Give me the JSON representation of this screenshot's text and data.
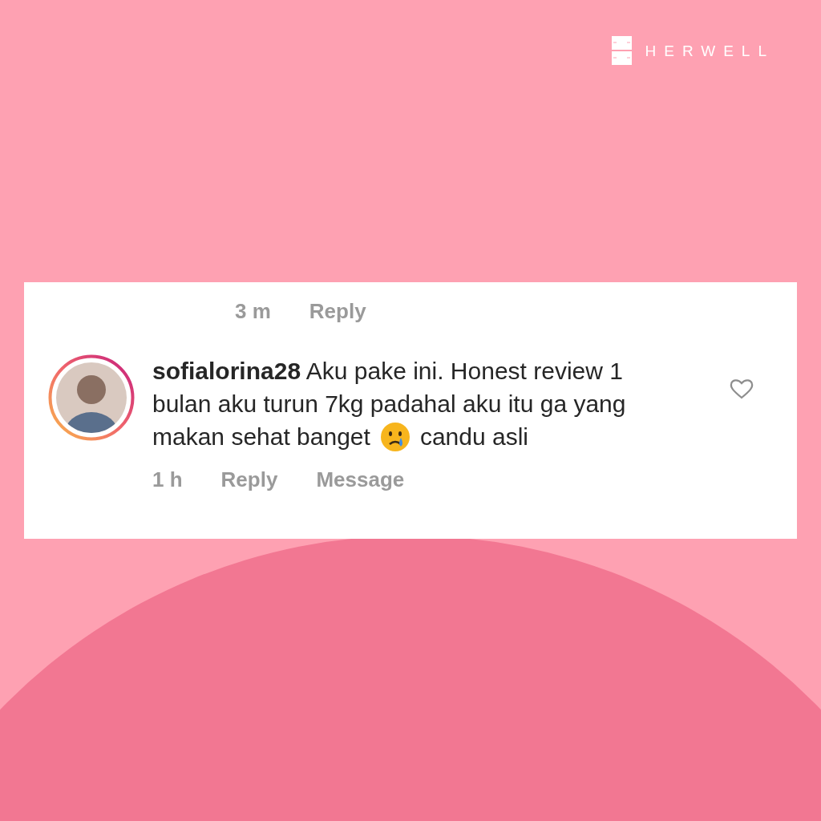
{
  "brand": {
    "name": "HERWELL"
  },
  "previous_comment": {
    "time": "3 m",
    "actions": [
      "Reply"
    ]
  },
  "comment": {
    "lines": [
      "**sofialorina28** Aku pake ini. Honest review 1",
      "bulan aku turun 7kg padahal aku itu ga yang",
      "makan sehat banget"
    ],
    "after_emoji": "candu asli",
    "liked": false,
    "time": "1 h",
    "actions": [
      "Reply",
      "Message"
    ]
  }
}
